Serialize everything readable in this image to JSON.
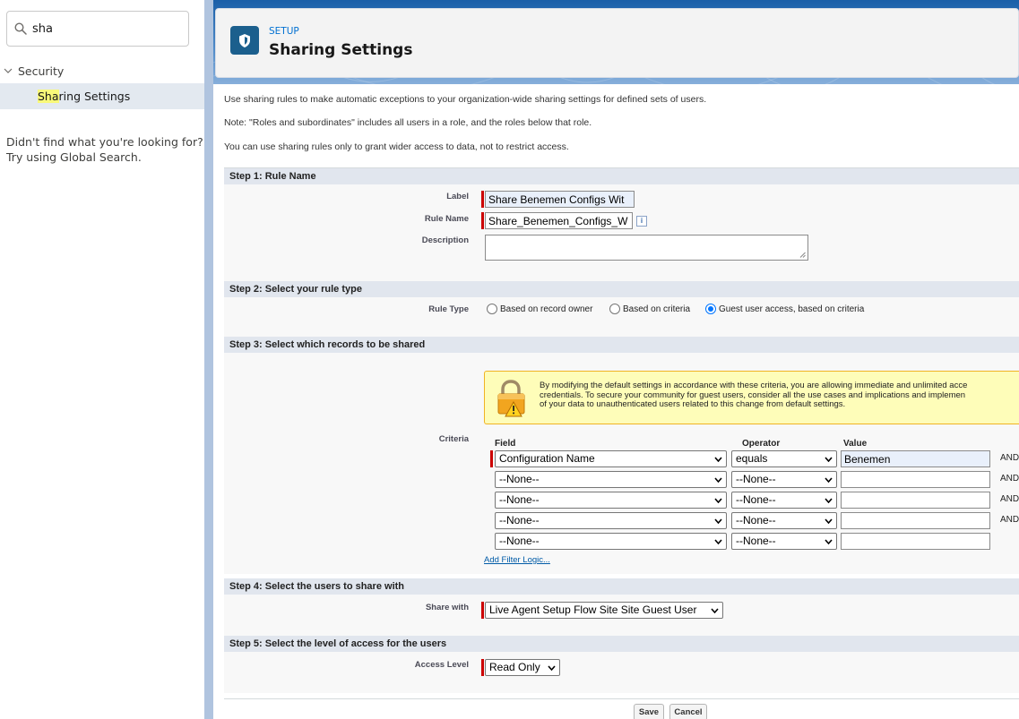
{
  "sidebar": {
    "search_value": "sha",
    "tree_parent": "Security",
    "tree_child_highlight": "Sha",
    "tree_child_rest": "ring Settings",
    "not_found_line1": "Didn't find what you're looking for?",
    "not_found_line2": "Try using Global Search."
  },
  "header": {
    "eyebrow": "SETUP",
    "title": "Sharing Settings",
    "band_color": "#1a5fa8",
    "icon": "shield-icon"
  },
  "intro": [
    "Use sharing rules to make automatic exceptions to your organization-wide sharing settings for defined sets of users.",
    "Note: \"Roles and subordinates\" includes all users in a role, and the roles below that role.",
    "You can use sharing rules only to grant wider access to data, not to restrict access."
  ],
  "step1": {
    "title": "Step 1: Rule Name",
    "label_label": "Label",
    "label_value": "Share Benemen Configs Wit",
    "rule_name_label": "Rule Name",
    "rule_name_value": "Share_Benemen_Configs_W",
    "description_label": "Description",
    "description_value": "",
    "info_icon": "i"
  },
  "step2": {
    "title": "Step 2: Select your rule type",
    "rule_type_label": "Rule Type",
    "options": [
      "Based on record owner",
      "Based on criteria",
      "Guest user access, based on criteria"
    ],
    "selected_index": 2
  },
  "step3": {
    "title": "Step 3: Select which records to be shared",
    "warning_lines": [
      "By modifying the default settings in accordance with these criteria, you are allowing immediate and unlimited acce",
      "credentials. To secure your community for guest users, consider all the use cases and implications and implemen",
      "of your data to unauthenticated users related to this change from default settings."
    ],
    "criteria_label": "Criteria",
    "col_field": "Field",
    "col_operator": "Operator",
    "col_value": "Value",
    "rows": [
      {
        "field": "Configuration Name",
        "operator": "equals",
        "value": "Benemen",
        "and": "AND"
      },
      {
        "field": "--None--",
        "operator": "--None--",
        "value": "",
        "and": "AND"
      },
      {
        "field": "--None--",
        "operator": "--None--",
        "value": "",
        "and": "AND"
      },
      {
        "field": "--None--",
        "operator": "--None--",
        "value": "",
        "and": "AND"
      },
      {
        "field": "--None--",
        "operator": "--None--",
        "value": "",
        "and": ""
      }
    ],
    "add_filter_logic": "Add Filter Logic..."
  },
  "step4": {
    "title": "Step 4: Select the users to share with",
    "share_with_label": "Share with",
    "share_with_value": "Live Agent Setup Flow Site Site Guest User"
  },
  "step5": {
    "title": "Step 5: Select the level of access for the users",
    "access_level_label": "Access Level",
    "access_level_value": "Read Only"
  },
  "buttons": {
    "save": "Save",
    "cancel": "Cancel"
  },
  "colors": {
    "accent": "#0070d2",
    "required": "#cc0000",
    "section_bar": "#e1e6ee",
    "warning_bg": "#fefdb9"
  }
}
